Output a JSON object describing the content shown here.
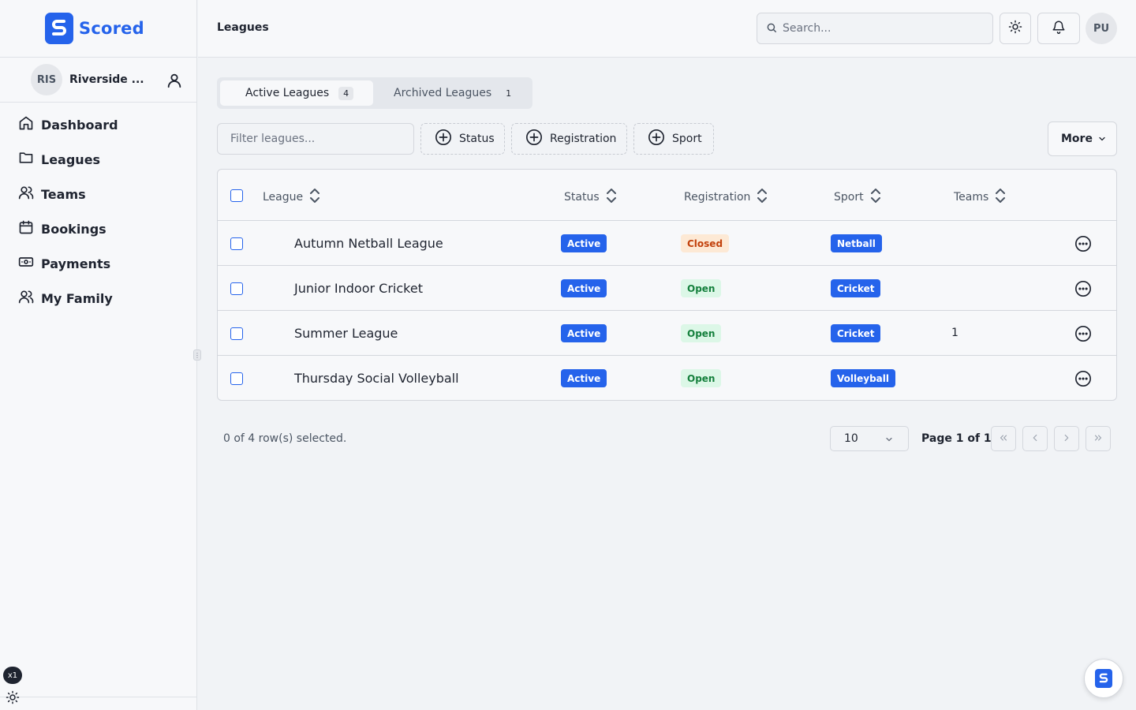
{
  "brand": {
    "name": "Scored",
    "accent": "#2563eb"
  },
  "club": {
    "initials": "RIS",
    "name": "Riverside ..."
  },
  "sidebar": {
    "items": [
      {
        "label": "Dashboard",
        "icon": "home-icon"
      },
      {
        "label": "Leagues",
        "icon": "folder-icon"
      },
      {
        "label": "Teams",
        "icon": "users-icon"
      },
      {
        "label": "Bookings",
        "icon": "calendar-icon"
      },
      {
        "label": "Payments",
        "icon": "banknote-icon"
      },
      {
        "label": "My Family",
        "icon": "users-icon"
      }
    ],
    "zoom_badge": "x1"
  },
  "header": {
    "title": "Leagues",
    "search_placeholder": "Search...",
    "user_initials": "PU"
  },
  "tabs": [
    {
      "label": "Active Leagues",
      "count": "4",
      "active": true
    },
    {
      "label": "Archived Leagues",
      "count": "1",
      "active": false
    }
  ],
  "filters": {
    "placeholder": "Filter leagues...",
    "facets": [
      "Status",
      "Registration",
      "Sport"
    ],
    "more_label": "More"
  },
  "table": {
    "columns": [
      "League",
      "Status",
      "Registration",
      "Sport",
      "Teams"
    ],
    "rows": [
      {
        "league": "Autumn Netball League",
        "status": "Active",
        "registration": "Closed",
        "sport": "Netball",
        "teams": ""
      },
      {
        "league": "Junior Indoor Cricket",
        "status": "Active",
        "registration": "Open",
        "sport": "Cricket",
        "teams": ""
      },
      {
        "league": "Summer League",
        "status": "Active",
        "registration": "Open",
        "sport": "Cricket",
        "teams": "1"
      },
      {
        "league": "Thursday Social Volleyball",
        "status": "Active",
        "registration": "Open",
        "sport": "Volleyball",
        "teams": ""
      }
    ]
  },
  "pagination": {
    "selected_text": "0 of 4 row(s) selected.",
    "page_size": "10",
    "page_info": "Page 1 of 1"
  }
}
